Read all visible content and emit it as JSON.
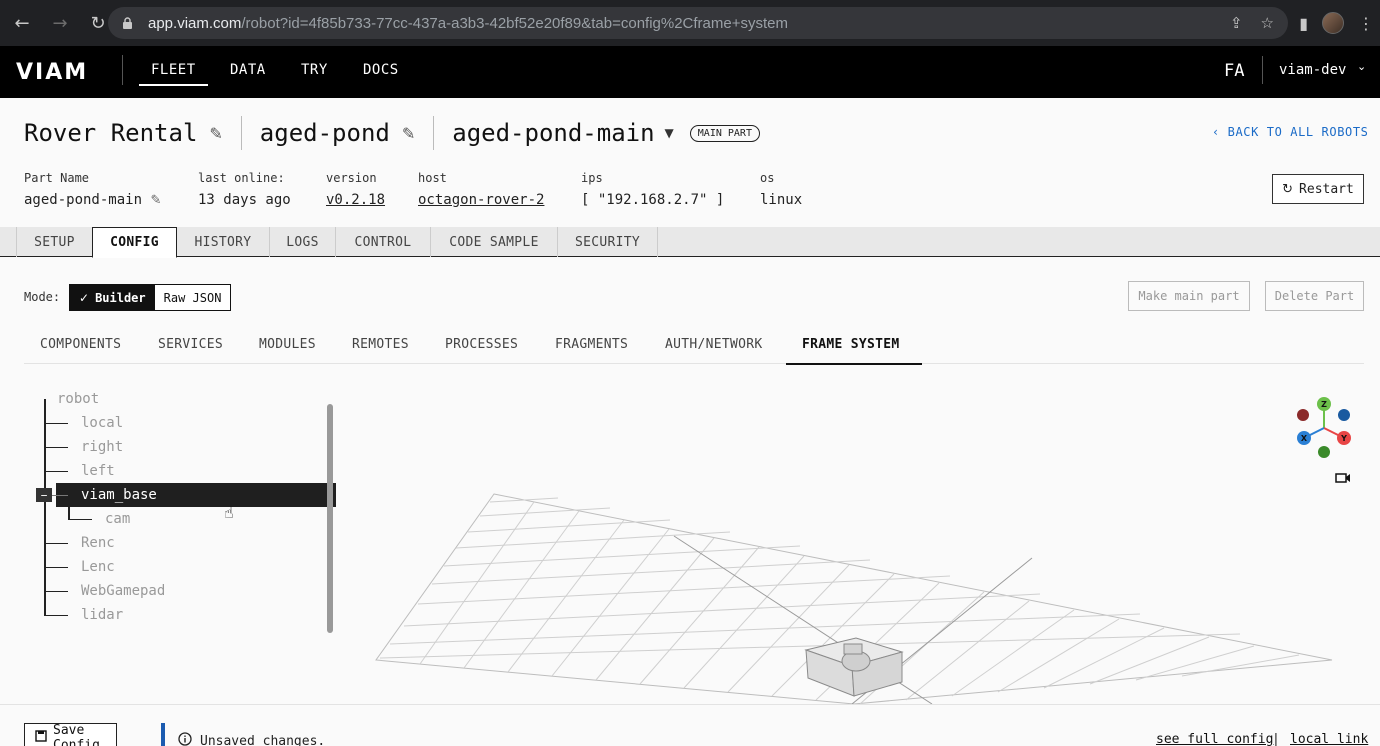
{
  "browser": {
    "url_host": "app.viam.com",
    "url_path": "/robot?id=4f85b733-77cc-437a-a3b3-42bf52e20f89&tab=config%2Cframe+system"
  },
  "appnav": {
    "logo": "VIAM",
    "links": [
      "FLEET",
      "DATA",
      "TRY",
      "DOCS"
    ],
    "active_link": "FLEET",
    "org_initials": "FA",
    "org_name": "viam-dev"
  },
  "header": {
    "robot_name": "Rover Rental",
    "location": "aged-pond",
    "part": "aged-pond-main",
    "part_badge": "MAIN PART",
    "back_link": "BACK TO ALL ROBOTS"
  },
  "meta": {
    "part_name_label": "Part Name",
    "part_name": "aged-pond-main",
    "last_online_label": "last online:",
    "last_online": "13 days ago",
    "version_label": "version",
    "version": "v0.2.18",
    "host_label": "host",
    "host": "octagon-rover-2",
    "ips_label": "ips",
    "ips": "[ \"192.168.2.7\" ]",
    "os_label": "os",
    "os": "linux",
    "restart_label": "Restart"
  },
  "tabs": [
    "SETUP",
    "CONFIG",
    "HISTORY",
    "LOGS",
    "CONTROL",
    "CODE SAMPLE",
    "SECURITY"
  ],
  "active_tab": "CONFIG",
  "config": {
    "mode_label": "Mode:",
    "mode_builder": "Builder",
    "mode_raw": "Raw JSON",
    "make_main_part": "Make main part",
    "delete_part": "Delete Part",
    "subtabs": [
      "COMPONENTS",
      "SERVICES",
      "MODULES",
      "REMOTES",
      "PROCESSES",
      "FRAGMENTS",
      "AUTH/NETWORK",
      "FRAME SYSTEM"
    ],
    "active_subtab": "FRAME SYSTEM"
  },
  "frame_tree": {
    "root": "robot",
    "nodes": [
      "local",
      "right",
      "left",
      "viam_base",
      "cam",
      "Renc",
      "Lenc",
      "WebGamepad",
      "lidar"
    ],
    "selected": "viam_base"
  },
  "gizmo_axes": [
    "Z",
    "Y",
    "X"
  ],
  "footer": {
    "save_label": "Save Config",
    "unsaved": "Unsaved changes.",
    "see_full_config": "see full config",
    "local_link": "local link"
  }
}
